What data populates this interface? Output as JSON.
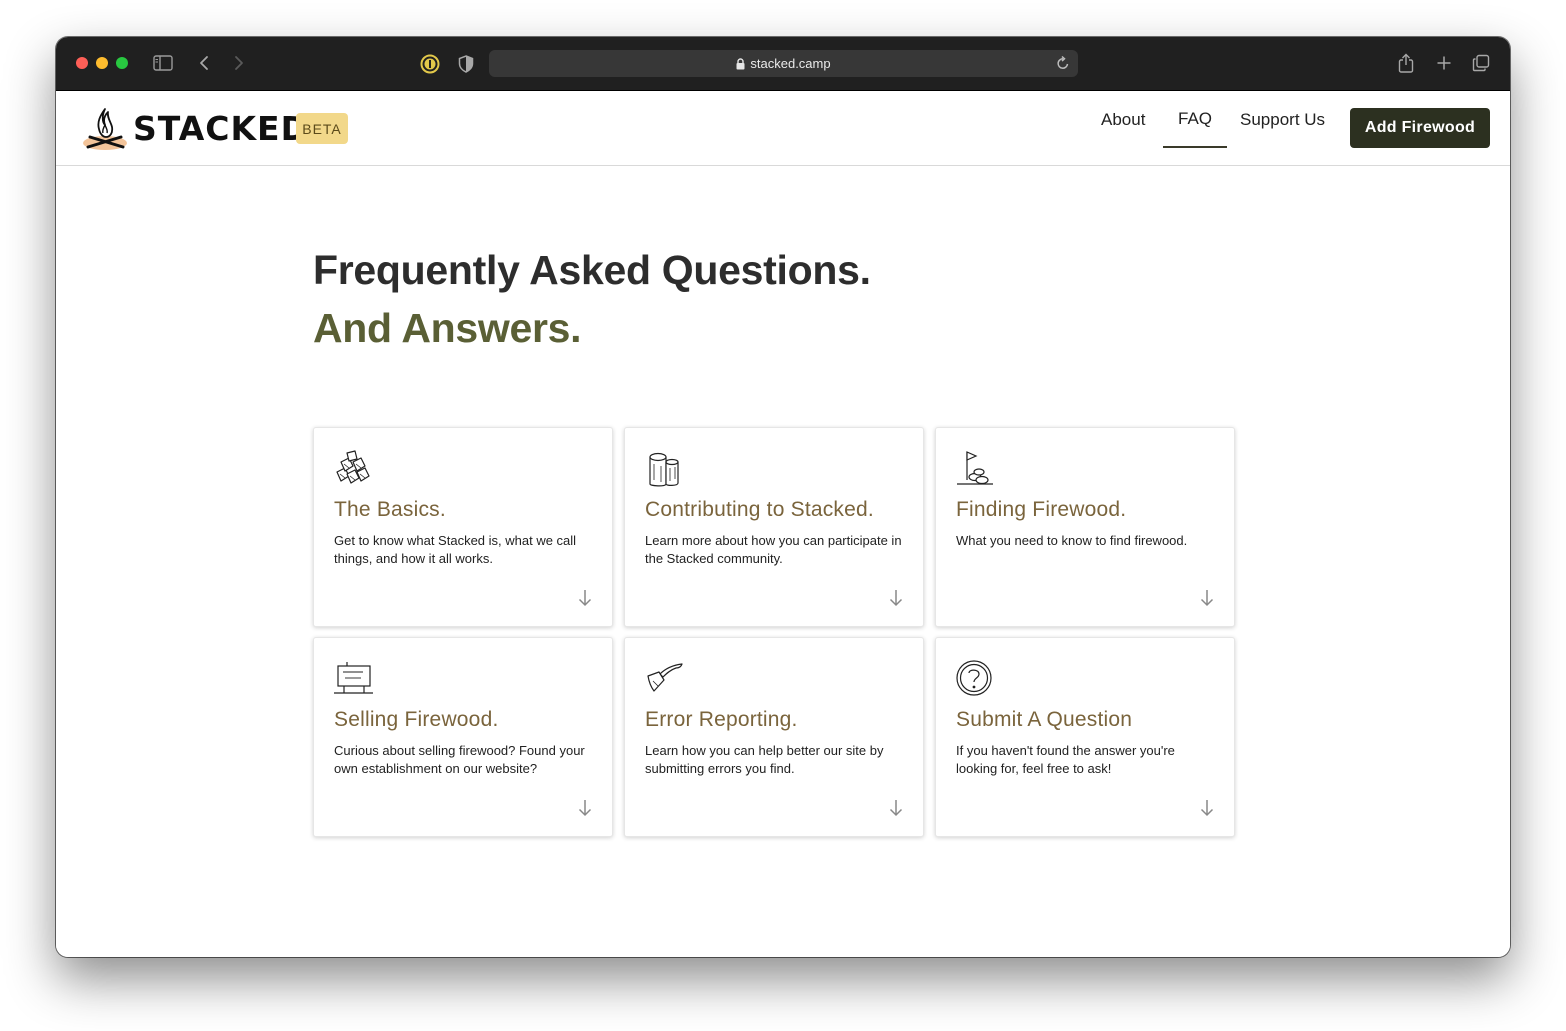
{
  "browser": {
    "url": "stacked.camp"
  },
  "site": {
    "logo_text": "STACKED",
    "badge": "BETA",
    "nav": {
      "about": "About",
      "faq": "FAQ",
      "support": "Support Us",
      "cta": "Add Firewood"
    }
  },
  "hero": {
    "title": "Frequently Asked Questions.",
    "subtitle": "And Answers."
  },
  "colors": {
    "accent_title": "#7a643c",
    "hero_sub": "#5a5f35",
    "cta_bg": "#2c3020",
    "beta_bg": "#f2d88a"
  },
  "cards": [
    {
      "icon": "firewood-pile-icon",
      "title": "The Basics.",
      "desc": "Get to know what Stacked is, what we call things, and how it all works."
    },
    {
      "icon": "log-stump-icon",
      "title": "Contributing to Stacked.",
      "desc": "Learn more about how you can participate in the Stacked community."
    },
    {
      "icon": "flag-on-logs-icon",
      "title": "Finding Firewood.",
      "desc": "What you need to know to find firewood."
    },
    {
      "icon": "for-sale-sign-icon",
      "title": "Selling Firewood.",
      "desc": "Curious about selling firewood? Found your own establishment on our website?"
    },
    {
      "icon": "axe-icon",
      "title": "Error Reporting.",
      "desc": "Learn how you can help better our site by submitting errors you find."
    },
    {
      "icon": "question-log-icon",
      "title": "Submit A Question",
      "desc": "If you haven't found the answer you're looking for, feel free to ask!"
    }
  ]
}
